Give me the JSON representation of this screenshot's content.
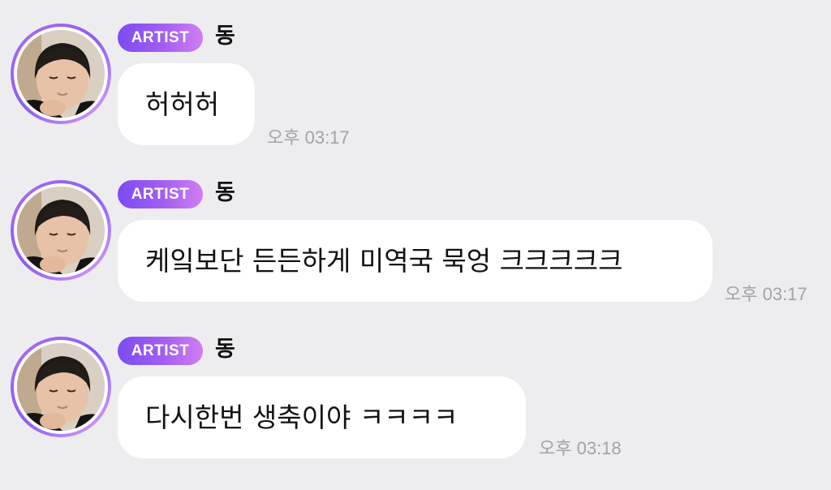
{
  "messages": [
    {
      "badge": "ARTIST",
      "sender": "동",
      "text": "허허허",
      "time": "오후 03:17"
    },
    {
      "badge": "ARTIST",
      "sender": "동",
      "text": "케잌보단 든든하게 미역국 묵엉 크크크크크",
      "time": "오후 03:17"
    },
    {
      "badge": "ARTIST",
      "sender": "동",
      "text": "다시한번 생축이야 ㅋㅋㅋㅋ",
      "time": "오후 03:18"
    }
  ],
  "colors": {
    "background": "#ededf0",
    "bubble": "#ffffff",
    "badge_gradient_start": "#7a4cf3",
    "badge_gradient_end": "#d07ef2",
    "timestamp": "#a3a3a8"
  },
  "icons": {
    "avatar": "artist-profile-photo"
  }
}
